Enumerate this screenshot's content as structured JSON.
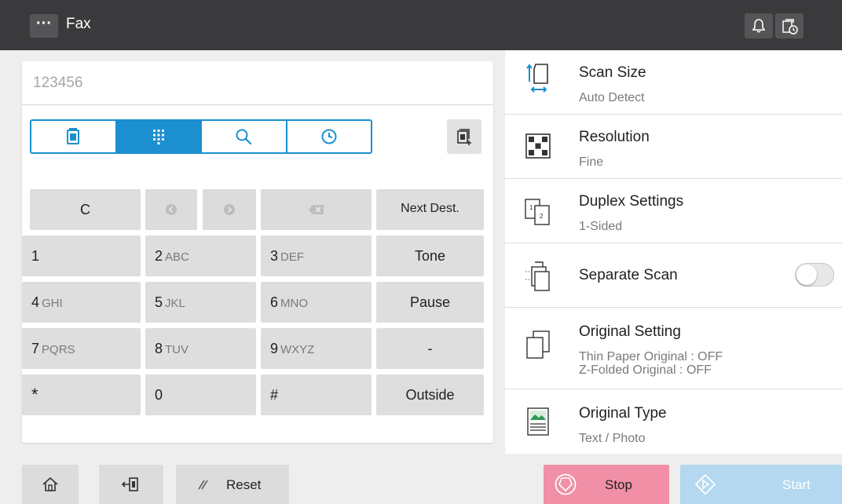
{
  "header": {
    "menu_label": "···",
    "title": "Fax",
    "icons": [
      "bell-icon",
      "job-status-icon"
    ]
  },
  "destination": {
    "value": "123456"
  },
  "tabs": [
    {
      "icon": "address-book-icon",
      "active": false
    },
    {
      "icon": "keypad-icon",
      "active": true
    },
    {
      "icon": "search-icon",
      "active": false
    },
    {
      "icon": "history-clock-icon",
      "active": false
    }
  ],
  "keypad": {
    "clear": "C",
    "next_dest": "Next Dest.",
    "keys": [
      {
        "num": "1",
        "letters": ""
      },
      {
        "num": "2",
        "letters": "ABC"
      },
      {
        "num": "3",
        "letters": "DEF"
      },
      {
        "num": "4",
        "letters": "GHI"
      },
      {
        "num": "5",
        "letters": "JKL"
      },
      {
        "num": "6",
        "letters": "MNO"
      },
      {
        "num": "7",
        "letters": "PQRS"
      },
      {
        "num": "8",
        "letters": "TUV"
      },
      {
        "num": "9",
        "letters": "WXYZ"
      },
      {
        "num": "*",
        "letters": ""
      },
      {
        "num": "0",
        "letters": ""
      },
      {
        "num": "#",
        "letters": ""
      }
    ],
    "side": [
      "Tone",
      "Pause",
      "-",
      "Outside"
    ]
  },
  "settings": [
    {
      "title": "Scan Size",
      "value": "Auto Detect",
      "icon": "scan-size-icon"
    },
    {
      "title": "Resolution",
      "value": "Fine",
      "icon": "resolution-icon"
    },
    {
      "title": "Duplex Settings",
      "value": "1-Sided",
      "icon": "duplex-icon"
    },
    {
      "title": "Separate Scan",
      "value": "",
      "icon": "separate-scan-icon",
      "toggle_on": false
    },
    {
      "title": "Original Setting",
      "value": "Thin Paper Original : OFF",
      "value2": "Z-Folded Original : OFF",
      "icon": "original-setting-icon"
    },
    {
      "title": "Original Type",
      "value": "Text / Photo",
      "icon": "original-type-icon"
    }
  ],
  "footer": {
    "reset_label": "Reset",
    "stop_label": "Stop",
    "start_label": "Start"
  },
  "colors": {
    "header_bg": "#3a3a3c",
    "accent_blue": "#1b8fd0",
    "stop_pink": "#f08fa6",
    "start_blue": "#b3d8ef"
  }
}
